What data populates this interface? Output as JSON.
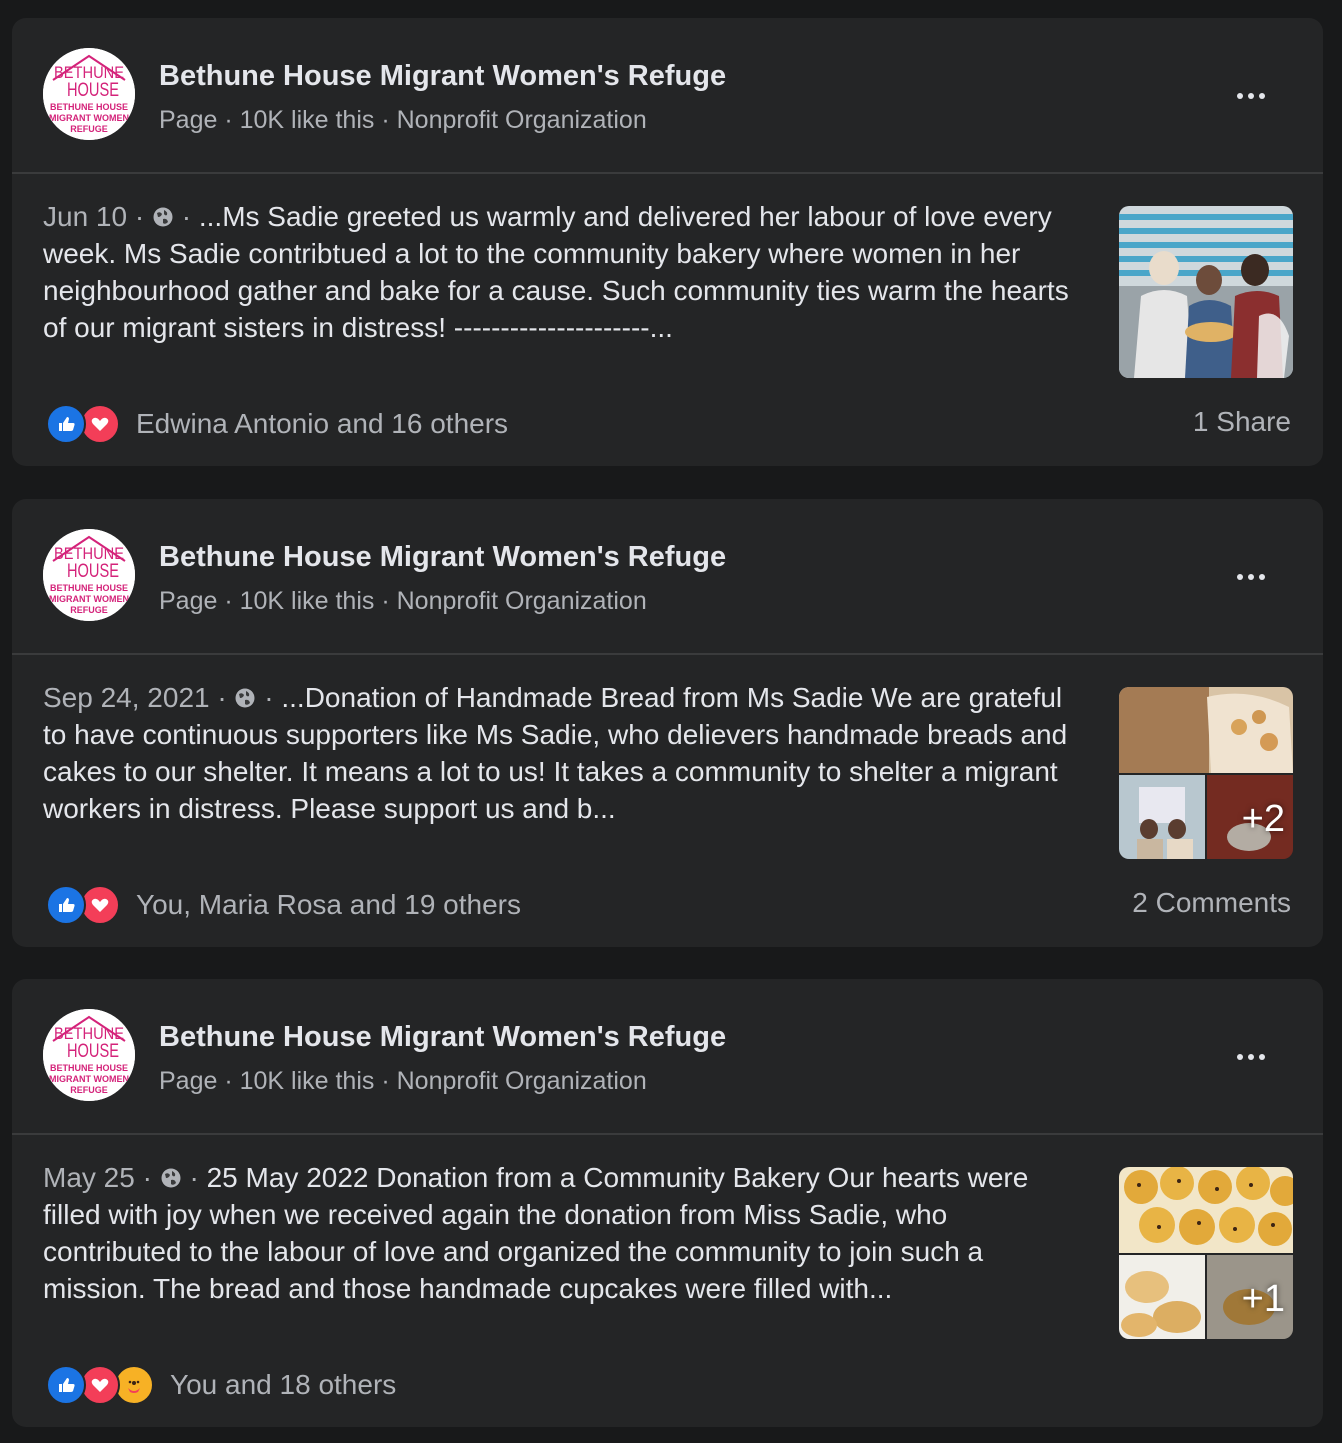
{
  "posts": [
    {
      "page_name": "Bethune House Migrant Women's Refuge",
      "page_meta": "Page · 10K like this · Nonprofit Organization",
      "date": "Jun 10",
      "text": "...Ms Sadie greeted us warmly and delivered her labour of love every week. Ms Sadie contribtued a lot to the community bakery where women in her neighbourhood gather and bake for a cause. Such community ties warm the hearts of our migrant sisters in distress! ---------------------...",
      "reactions_text": "Edwina Antonio and 16 others",
      "footer_right": "1 Share",
      "more_photos": ""
    },
    {
      "page_name": "Bethune House Migrant Women's Refuge",
      "page_meta": "Page · 10K like this · Nonprofit Organization",
      "date": "Sep 24, 2021",
      "text": "...Donation of Handmade Bread from Ms Sadie We are grateful to have continuous supporters like Ms Sadie, who delievers handmade breads and cakes to our shelter. It means a lot to us! It takes a community to shelter a migrant workers in distress. Please support us and b...",
      "reactions_text": "You, Maria Rosa and 19 others",
      "footer_right": "2 Comments",
      "more_photos": "+2"
    },
    {
      "page_name": "Bethune House Migrant Women's Refuge",
      "page_meta": "Page · 10K like this · Nonprofit Organization",
      "date": "May 25",
      "text": "25 May 2022 Donation from a Community Bakery Our hearts were filled with joy when we received again the donation from Miss Sadie, who contributed to the labour of love and organized the community to join such a mission. The bread and those handmade cupcakes were filled with...",
      "reactions_text": "You and 18 others",
      "footer_right": "",
      "more_photos": "+1"
    }
  ],
  "logo": {
    "line1": "BETHUNE",
    "line2": "HOUSE",
    "line3": "BETHUNE HOUSE",
    "line4": "MIGRANT WOMEN",
    "line5": "REFUGE"
  },
  "separator": " · ",
  "colors": {
    "background": "#18191a",
    "card": "#242526",
    "primary_text": "#e4e6eb",
    "secondary_text": "#b0b3b8",
    "like_blue": "#1b74e4",
    "love_red": "#f33e58",
    "care_yellow": "#f7b125",
    "logo_magenta": "#d4237a"
  },
  "icons": {
    "more": "more-horizontal-icon",
    "globe": "globe-icon",
    "like": "like-icon",
    "love": "love-icon",
    "care": "care-icon"
  }
}
